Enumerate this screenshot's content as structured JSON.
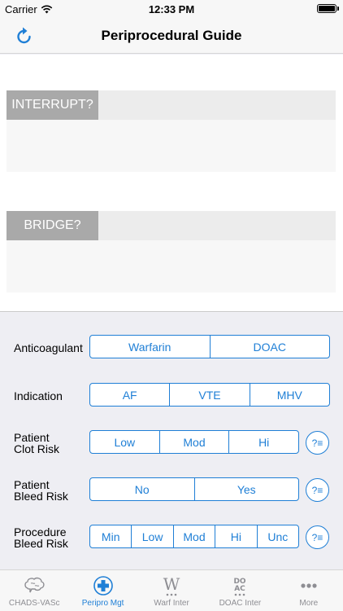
{
  "status": {
    "carrier": "Carrier",
    "time": "12:33 PM"
  },
  "nav": {
    "title": "Periprocedural Guide"
  },
  "sections": [
    {
      "label": "INTERRUPT?"
    },
    {
      "label": "BRIDGE?"
    }
  ],
  "controls": {
    "anticoagulant": {
      "label": "Anticoagulant",
      "options": [
        "Warfarin",
        "DOAC"
      ]
    },
    "indication": {
      "label": "Indication",
      "options": [
        "AF",
        "VTE",
        "MHV"
      ]
    },
    "clot_risk": {
      "label_line1": "Patient",
      "label_line2": "Clot Risk",
      "options": [
        "Low",
        "Mod",
        "Hi"
      ],
      "help": "?≡"
    },
    "bleed_risk": {
      "label_line1": "Patient",
      "label_line2": "Bleed Risk",
      "options": [
        "No",
        "Yes"
      ],
      "help": "?≡"
    },
    "procedure_bleed": {
      "label_line1": "Procedure",
      "label_line2": "Bleed Risk",
      "options": [
        "Min",
        "Low",
        "Mod",
        "Hi",
        "Unc"
      ],
      "help": "?≡"
    }
  },
  "tabs": [
    {
      "label": "CHADS-VASc",
      "icon": "brain-icon"
    },
    {
      "label": "Peripro Mgt",
      "icon": "medical-cross-icon",
      "active": true
    },
    {
      "label": "Warf Inter",
      "icon": "warfarin-w-icon"
    },
    {
      "label": "DOAC Inter",
      "icon": "doac-icon"
    },
    {
      "label": "More",
      "icon": "more-icon"
    }
  ],
  "colors": {
    "accent": "#1f7fd6",
    "section_label_bg": "#a9a9a9"
  }
}
